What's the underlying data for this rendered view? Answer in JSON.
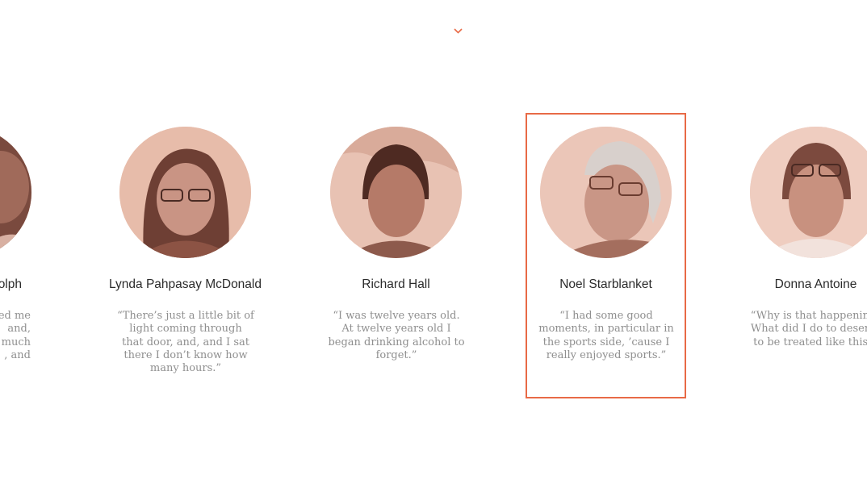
{
  "header": {
    "chevron_icon": "chevron-down-icon",
    "accent_color": "#e86a46"
  },
  "carousel": {
    "cards": [
      {
        "name": "…olph",
        "quote": "…ed me and, much , and"
      },
      {
        "name": "Lynda Pahpasay McDonald",
        "quote": "“There’s just a little bit of light coming through that door, and, and I sat there I don’t know how many hours.”"
      },
      {
        "name": "Richard Hall",
        "quote": "“I was twelve years old. At twelve years old I began drinking alcohol to forget.”"
      },
      {
        "name": "Noel Starblanket",
        "quote": "“I had some good moments, in particular in the sports side, ’cause I really enjoyed sports.”"
      },
      {
        "name": "Donna Antoine",
        "quote": "“Why is that happening? What did I do to deserve to be treated like this?”"
      }
    ],
    "cropped_left_name": "olph",
    "cropped_left_quote_lines": [
      "ed me",
      "and,",
      "much",
      ", and"
    ]
  }
}
